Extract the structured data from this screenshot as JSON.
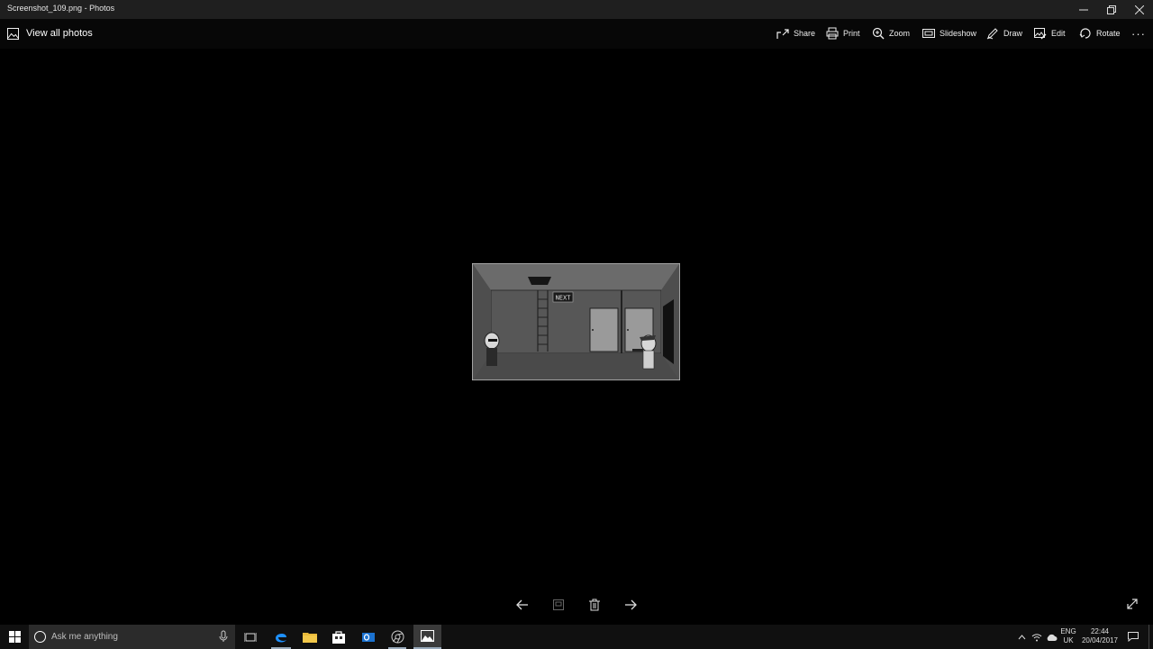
{
  "window": {
    "title": "Screenshot_109.png - Photos"
  },
  "toolbar": {
    "view_all": "View all photos",
    "share": "Share",
    "print": "Print",
    "zoom": "Zoom",
    "slideshow": "Slideshow",
    "draw": "Draw",
    "edit": "Edit",
    "rotate": "Rotate",
    "more": "···"
  },
  "photo": {
    "sign_text": "NEXT"
  },
  "taskbar": {
    "search_placeholder": "Ask me anything",
    "lang_line1": "ENG",
    "lang_line2": "UK",
    "time": "22:44",
    "date": "20/04/2017"
  },
  "icons": [
    "photo-icon",
    "share-icon",
    "print-icon",
    "zoom-icon",
    "slideshow-icon",
    "draw-icon",
    "edit-icon",
    "rotate-icon",
    "arrow-left-icon",
    "arrow-right-icon",
    "delete-icon",
    "fullscreen-icon",
    "windows-icon",
    "cortana-icon",
    "microphone-icon",
    "task-view-icon",
    "edge-icon",
    "file-explorer-icon",
    "store-icon",
    "outlook-icon",
    "chrome-icon",
    "photos-icon",
    "chevron-up-icon",
    "network-icon",
    "onedrive-icon",
    "notification-icon"
  ],
  "colors": {
    "background": "#000000",
    "titlebar": "#1f1f1f",
    "taskbar": "#101010"
  }
}
